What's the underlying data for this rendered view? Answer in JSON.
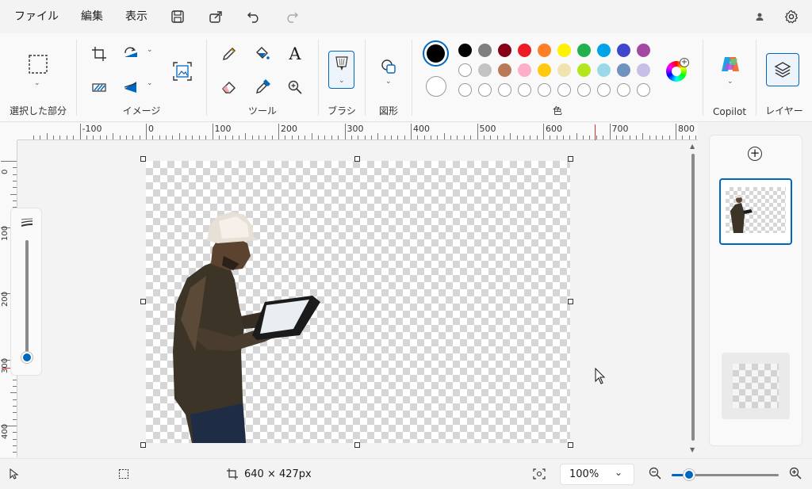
{
  "menu": {
    "items": [
      "ファイル",
      "編集",
      "表示"
    ]
  },
  "ribbon": {
    "groups": {
      "selection": "選択した部分",
      "image": "イメージ",
      "tools": "ツール",
      "brush": "ブラシ",
      "shapes": "図形",
      "colors": "色",
      "copilot": "Copilot",
      "layers": "レイヤー"
    },
    "text_tool": "A",
    "primary_color": "#000000",
    "secondary_color": "#ffffff",
    "palette_row1": [
      "#000000",
      "#7f7f7f",
      "#880015",
      "#ed1c24",
      "#ff7f27",
      "#fff200",
      "#22b14c",
      "#00a2e8",
      "#3f48cc",
      "#a349a4"
    ],
    "palette_row2": [
      "",
      "#c3c3c3",
      "#b97a57",
      "#ffaec9",
      "#ffc90e",
      "#efe4b0",
      "#b5e61d",
      "#99d9ea",
      "#7092be",
      "#c8bfe7"
    ],
    "palette_row3": [
      "",
      "",
      "",
      "",
      "",
      "",
      "",
      "",
      "",
      ""
    ]
  },
  "ruler": {
    "h_labels": [
      "-100",
      "0",
      "100",
      "200",
      "300",
      "400",
      "500",
      "600",
      "700",
      "800"
    ],
    "v_labels": [
      "0",
      "100",
      "200",
      "300",
      "400"
    ]
  },
  "status": {
    "image_size": "640 × 427px",
    "zoom": "100%"
  },
  "accent_color": "#0067c0"
}
